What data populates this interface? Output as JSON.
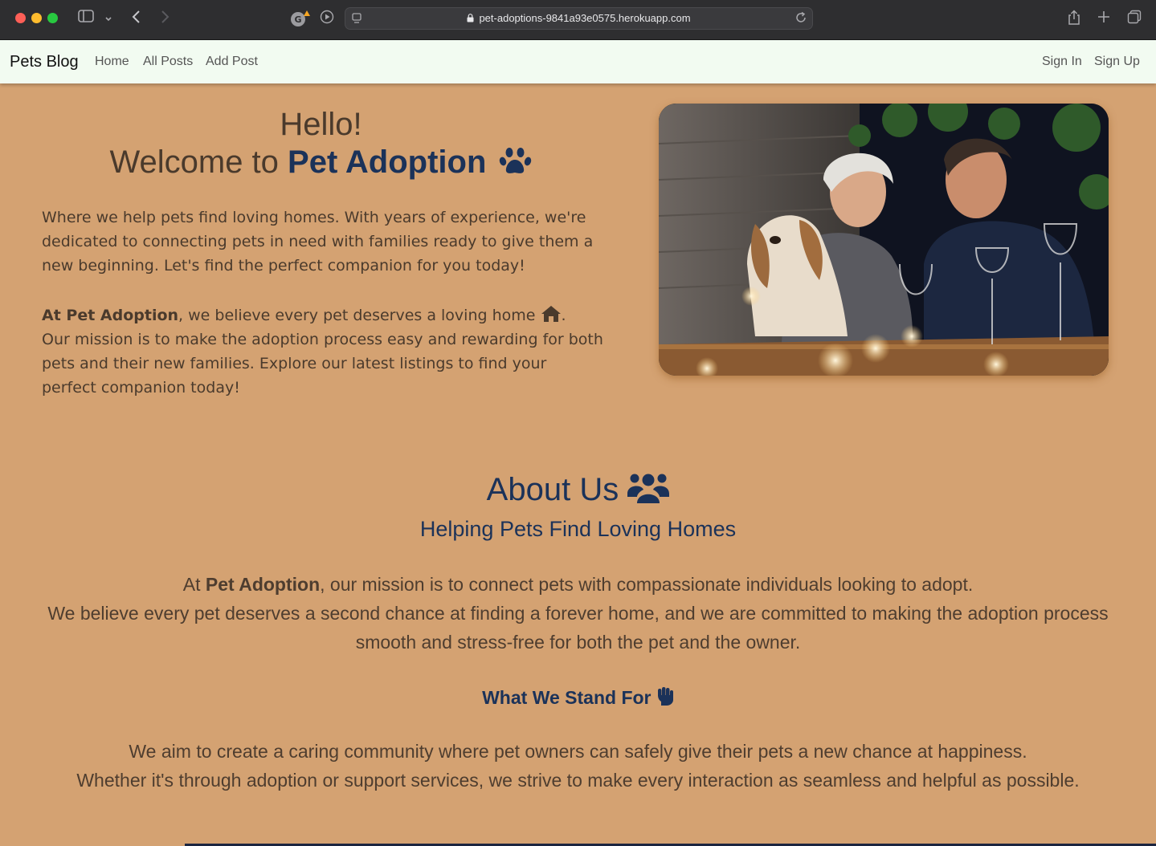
{
  "browser": {
    "url": "pet-adoptions-9841a93e0575.herokuapp.com"
  },
  "navbar": {
    "brand": "Pets Blog",
    "links": [
      "Home",
      "All Posts",
      "Add Post"
    ],
    "auth": [
      "Sign In",
      "Sign Up"
    ]
  },
  "hero": {
    "hello": "Hello!",
    "welcome_prefix": "Welcome to ",
    "welcome_brand": "Pet Adoption",
    "intro": "Where we help pets find loving homes. With years of experience, we're dedicated to connecting pets in need with families ready to give them a new beginning. Let's find the perfect companion for you today!",
    "belief_bold": "At Pet Adoption",
    "belief_rest": ", we believe every pet deserves a loving home ",
    "belief_end": ".",
    "mission": "Our mission is to make the adoption process easy and rewarding for both pets and their new families. Explore our latest listings to find your perfect companion today!"
  },
  "about": {
    "title": "About Us",
    "subtitle": "Helping Pets Find Loving Homes",
    "p1_prefix": "At ",
    "p1_bold": "Pet Adoption",
    "p1_rest": ", our mission is to connect pets with compassionate individuals looking to adopt.",
    "p1_line2": "We believe every pet deserves a second chance at finding a forever home, and we are committed to making the adoption process smooth and stress-free for both the pet and the owner.",
    "stand_title": "What We Stand For",
    "p2_line1": "We aim to create a caring community where pet owners can safely give their pets a new chance at happiness.",
    "p2_line2": "Whether it's through adoption or support services, we strive to make every interaction as seamless and helpful as possible."
  },
  "colors": {
    "page_bg": "#d4a272",
    "navbar_bg": "#f2fbf1",
    "brand_blue": "#1b3259",
    "text_brown": "#4a3a2c"
  },
  "icons": [
    "paw-icon",
    "home-icon",
    "users-icon",
    "fist-icon"
  ]
}
